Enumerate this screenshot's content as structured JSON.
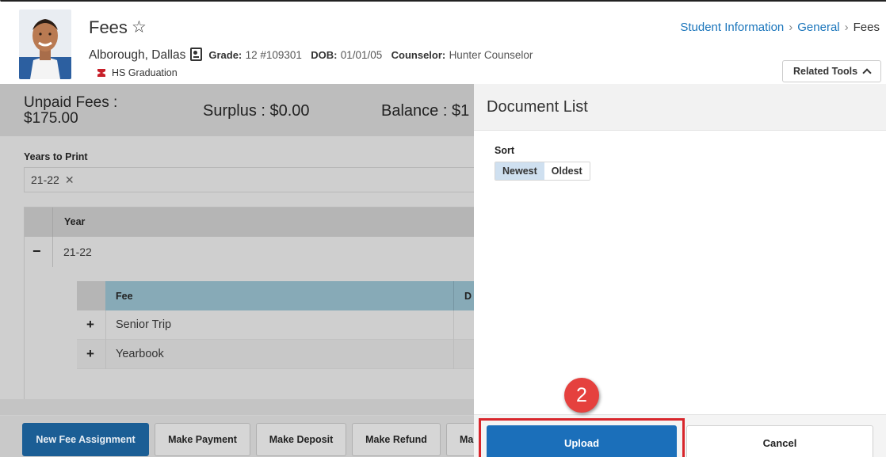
{
  "header": {
    "page_title": "Fees",
    "student_name": "Alborough, Dallas",
    "grade_label": "Grade:",
    "grade_value": "12 #109301",
    "dob_label": "DOB:",
    "dob_value": "01/01/05",
    "counselor_label": "Counselor:",
    "counselor_value": "Hunter Counselor",
    "program": "HS Graduation",
    "related_tools_label": "Related Tools"
  },
  "breadcrumb": {
    "items": [
      "Student Information",
      "General",
      "Fees"
    ]
  },
  "summary": {
    "unpaid_label": "Unpaid Fees :",
    "unpaid_value": "$175.00",
    "surplus": "Surplus : $0.00",
    "balance": "Balance : $1"
  },
  "years": {
    "label": "Years to Print",
    "chip": "21-22",
    "chip_remove": "✕"
  },
  "grid": {
    "year_header": "Year",
    "year_row": "21-22",
    "collapse_glyph": "−",
    "fee_header": "Fee",
    "second_header": "D",
    "fees": [
      {
        "name": "Senior Trip",
        "expand": "+"
      },
      {
        "name": "Yearbook",
        "expand": "+"
      }
    ]
  },
  "actions": {
    "new_fee_assignment": "New Fee Assignment",
    "make_payment": "Make Payment",
    "make_deposit": "Make Deposit",
    "make_refund": "Make Refund",
    "truncated": "Ma"
  },
  "document_list": {
    "title": "Document List",
    "sort_label": "Sort",
    "sort_newest": "Newest",
    "sort_oldest": "Oldest",
    "upload_label": "Upload",
    "cancel_label": "Cancel"
  },
  "annotation": {
    "step_number": "2"
  },
  "colors": {
    "link": "#1a75bb",
    "primary_button": "#1b6fba",
    "callout": "#d8262c",
    "badge": "#e5413e",
    "fee_header": "#87aab7"
  }
}
